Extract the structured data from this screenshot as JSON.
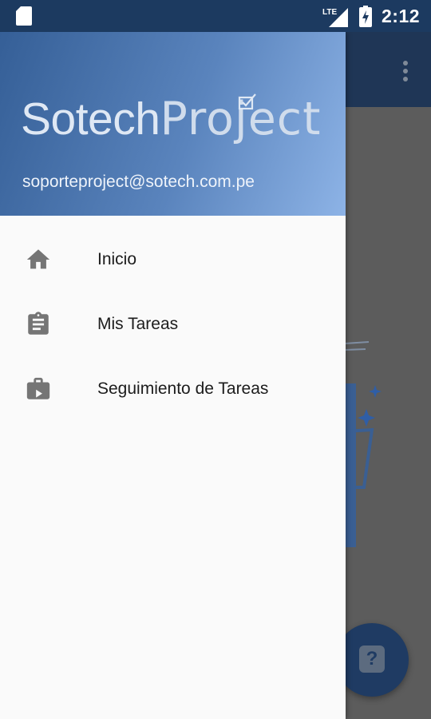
{
  "status_bar": {
    "time": "2:12",
    "network": "LTE"
  },
  "drawer": {
    "brand": {
      "part1": "Sotech",
      "part2": "Project"
    },
    "email": "soporteproject@sotech.com.pe",
    "items": [
      {
        "label": "Inicio",
        "icon": "home-icon"
      },
      {
        "label": "Mis Tareas",
        "icon": "clipboard-icon"
      },
      {
        "label": "Seguimiento de Tareas",
        "icon": "briefcase-icon"
      }
    ]
  },
  "colors": {
    "status_bar": "#1c3a60",
    "header_gradient_start": "#355f97",
    "header_gradient_end": "#8db3e6",
    "icon_gray": "#757575",
    "scrim": "#5c5c5c"
  }
}
